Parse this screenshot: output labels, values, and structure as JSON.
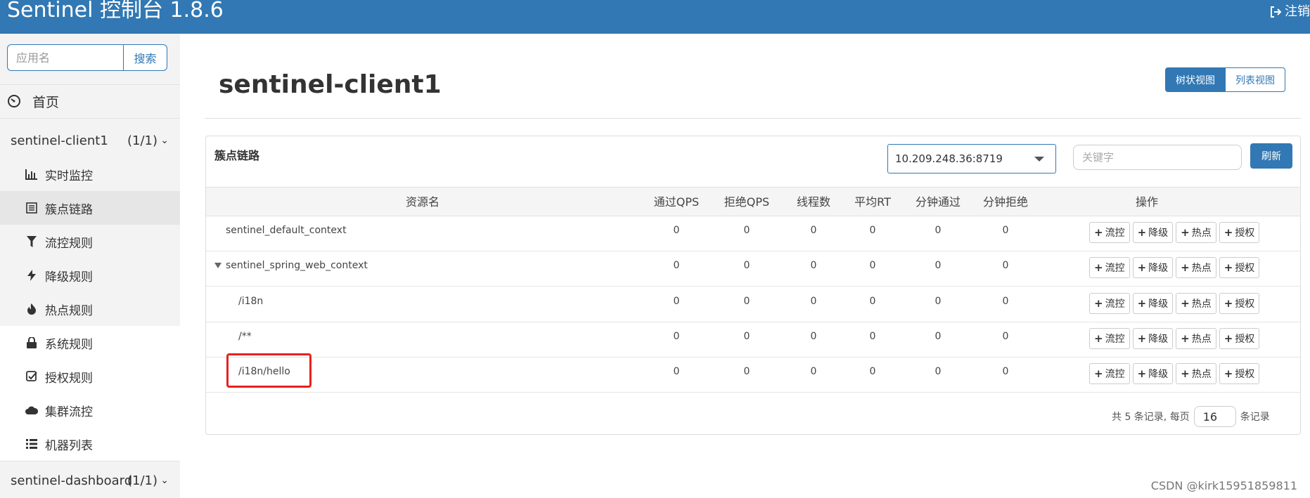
{
  "header": {
    "brand": "Sentinel 控制台 1.8.6",
    "logout_label": "注销"
  },
  "sidebar": {
    "search_placeholder": "应用名",
    "search_button": "搜索",
    "home_label": "首页",
    "apps": [
      {
        "name": "sentinel-client1",
        "count": "(1/1)"
      },
      {
        "name": "sentinel-dashboard",
        "count": "(1/1)"
      }
    ],
    "menu": [
      {
        "label": "实时监控",
        "icon": "bar-chart-icon"
      },
      {
        "label": "簇点链路",
        "icon": "list-icon",
        "active": true
      },
      {
        "label": "流控规则",
        "icon": "filter-icon"
      },
      {
        "label": "降级规则",
        "icon": "flash-icon"
      },
      {
        "label": "热点规则",
        "icon": "fire-icon"
      },
      {
        "label": "系统规则",
        "icon": "lock-icon"
      },
      {
        "label": "授权规则",
        "icon": "check-icon"
      },
      {
        "label": "集群流控",
        "icon": "cloud-icon"
      },
      {
        "label": "机器列表",
        "icon": "list-bullets-icon"
      }
    ]
  },
  "main": {
    "title": "sentinel-client1",
    "view_toggle": {
      "tree": "树状视图",
      "list": "列表视图"
    },
    "panel_title": "簇点链路",
    "machine": "10.209.248.36:8719",
    "keyword_placeholder": "关键字",
    "refresh_button": "刷新",
    "columns": [
      "资源名",
      "通过QPS",
      "拒绝QPS",
      "线程数",
      "平均RT",
      "分钟通过",
      "分钟拒绝",
      "操作"
    ],
    "rows": [
      {
        "name": "sentinel_default_context",
        "values": [
          "0",
          "0",
          "0",
          "0",
          "0",
          "0"
        ]
      },
      {
        "name": "sentinel_spring_web_context",
        "values": [
          "0",
          "0",
          "0",
          "0",
          "0",
          "0"
        ]
      },
      {
        "name": "/i18n",
        "values": [
          "0",
          "0",
          "0",
          "0",
          "0",
          "0"
        ]
      },
      {
        "name": "/**",
        "values": [
          "0",
          "0",
          "0",
          "0",
          "0",
          "0"
        ]
      },
      {
        "name": "/i18n/hello",
        "values": [
          "0",
          "0",
          "0",
          "0",
          "0",
          "0"
        ]
      }
    ],
    "ops": [
      "流控",
      "降级",
      "热点",
      "授权"
    ],
    "pager": {
      "prefix": "共 5 条记录, 每页",
      "page_size": "16",
      "suffix": "条记录"
    }
  },
  "watermark": "CSDN @kirk15951859811"
}
